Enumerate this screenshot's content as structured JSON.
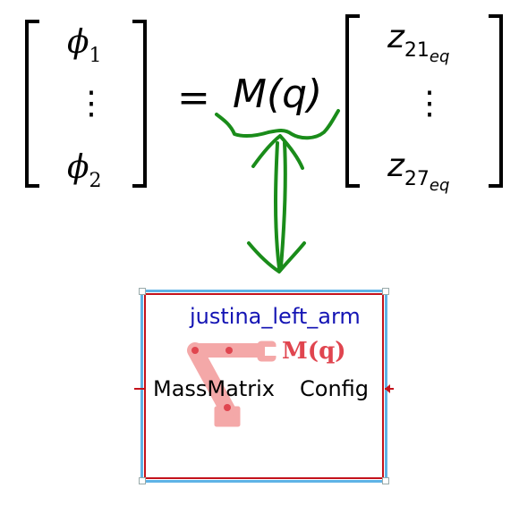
{
  "equation": {
    "lhs": [
      {
        "base": "ϕ",
        "sub": "1"
      },
      {
        "dots": "⋮"
      },
      {
        "base": "ϕ",
        "sub": "2"
      }
    ],
    "equals": "=",
    "operator": "M(q)",
    "rhs": [
      {
        "base": "z",
        "sub": "21",
        "subsub": "eq"
      },
      {
        "dots": "⋮"
      },
      {
        "base": "z",
        "sub": "27",
        "subsub": "eq"
      }
    ]
  },
  "annotation": {
    "color": "#1a8c1a",
    "arrow": "double-headed"
  },
  "block": {
    "name": "justina_left_arm",
    "left_port": "MassMatrix",
    "right_port": "Config",
    "icon_label": "M(q)",
    "icon_name": "robot-arm-icon",
    "colors": {
      "name": "#1414b4",
      "border": "#c4121b",
      "selection": "#5fb3e6",
      "icon": "#f4a8a8"
    }
  }
}
